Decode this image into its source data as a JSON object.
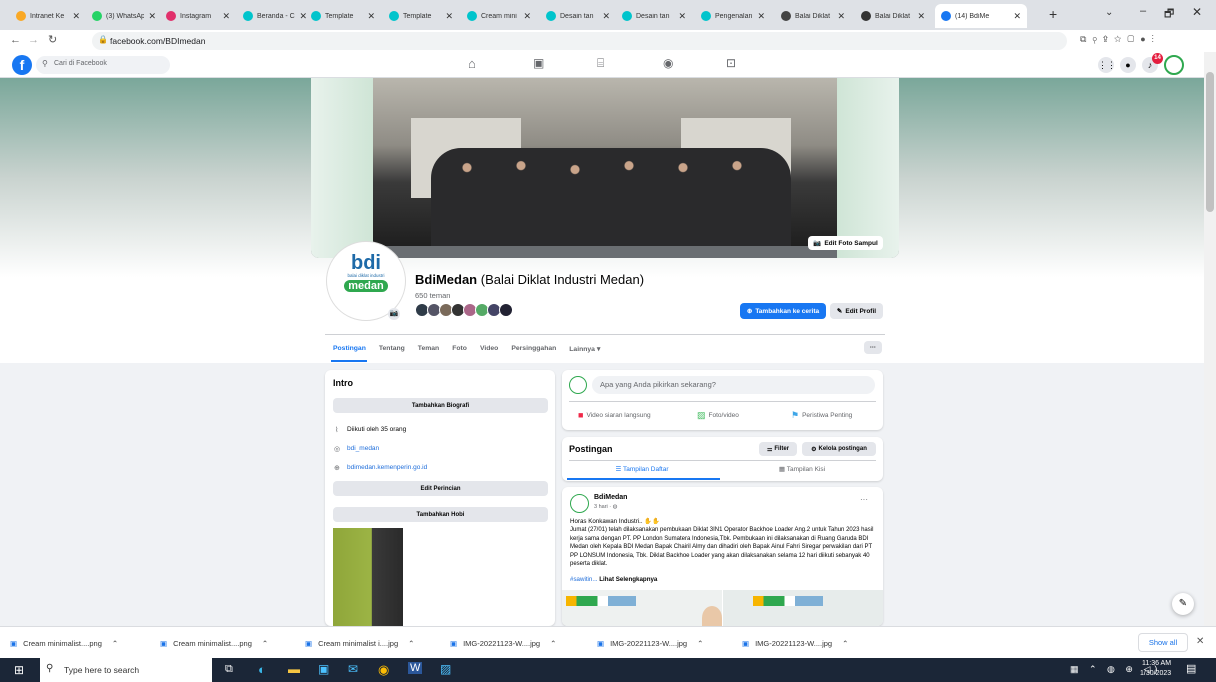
{
  "browser": {
    "tabs": [
      {
        "label": "Intranet Ke",
        "color": "#f9a825"
      },
      {
        "label": "(3) WhatsAp",
        "color": "#25d366"
      },
      {
        "label": "Instagram",
        "color": "#e1306c"
      },
      {
        "label": "Beranda - C",
        "color": "#00c4cc"
      },
      {
        "label": "Template",
        "color": "#00c4cc"
      },
      {
        "label": "Template",
        "color": "#00c4cc"
      },
      {
        "label": "Cream mini",
        "color": "#00c4cc"
      },
      {
        "label": "Desain tan",
        "color": "#00c4cc"
      },
      {
        "label": "Desain tan",
        "color": "#00c4cc"
      },
      {
        "label": "Pengenalan",
        "color": "#00c4cc"
      },
      {
        "label": "Balai Diklat",
        "color": "#444"
      },
      {
        "label": "Balai Diklat",
        "color": "#333"
      },
      {
        "label": "(14) BdiMe",
        "color": "#1877f2"
      }
    ],
    "url": "facebook.com/BDImedan"
  },
  "fb": {
    "search_placeholder": "Cari di Facebook",
    "notif_count": "14",
    "edit_cover": "Edit Foto Sampul",
    "page_name": "BdiMedan",
    "page_name_alt": "(Balai Diklat Industri Medan)",
    "friends": "650 teman",
    "add_story": "Tambahkan ke cerita",
    "edit_profile": "Edit Profil",
    "profile_logo": {
      "top": "bdi",
      "mid": "balai diklat industri",
      "bottom": "medan"
    },
    "nav_tabs": [
      "Postingan",
      "Tentang",
      "Teman",
      "Foto",
      "Video",
      "Persinggahan",
      "Lainnya ▾"
    ],
    "intro": {
      "title": "Intro",
      "add_bio": "Tambahkan Biografi",
      "followed_by": "Diikuti oleh 35 orang",
      "instagram": "bdi_medan",
      "website": "bdimedan.kemenperin.go.id",
      "edit_details": "Edit Perincian",
      "add_hobby": "Tambahkan Hobi"
    },
    "composer": {
      "placeholder": "Apa yang Anda pikirkan sekarang?",
      "live": "Video siaran langsung",
      "photo": "Foto/video",
      "event": "Peristiwa Penting"
    },
    "posts_header": {
      "title": "Postingan",
      "filter": "Filter",
      "manage": "Kelola postingan",
      "list_view": "Tampilan Daftar",
      "grid_view": "Tampilan Kisi"
    },
    "post": {
      "author": "BdiMedan",
      "time": "3 hari · ",
      "greeting": "Horas Konkawan Industri..",
      "body": "Jumat (27/01) telah dilaksanakan pembukaan Diklat 3IN1 Operator Backhoe Loader Ang.2 untuk Tahun 2023 hasil kerja sama dengan PT. PP London Sumatera Indonesia,Tbk. Pembukaan ini dilaksanakan di Ruang Garuda BDI Medan oleh Kepala BDI Medan Bapak Chairil Almy dan dihadiri oleh Bapak Ainul Fahri Siregar perwakilan dari PT PP LONSUM Indonesia, Tbk. Diklat Backhoe Loader yang akan dilaksanakan selama 12 hari diikuti sebanyak 40 peserta diklat.",
      "hashtag": "#sawitin...",
      "see_more": "Lihat Selengkapnya"
    }
  },
  "downloads": {
    "items": [
      "Cream minimalist....png",
      "Cream minimalist....png",
      "Cream minimalist i....jpg",
      "IMG-20221123-W....jpg",
      "IMG-20221123-W....jpg",
      "IMG-20221123-W....jpg"
    ],
    "show_all": "Show all"
  },
  "taskbar": {
    "search": "Type here to search",
    "time": "11:36 AM",
    "date": "1/30/2023"
  },
  "colors": {
    "fb_blue": "#1877f2",
    "accent_green": "#2fa84f"
  }
}
